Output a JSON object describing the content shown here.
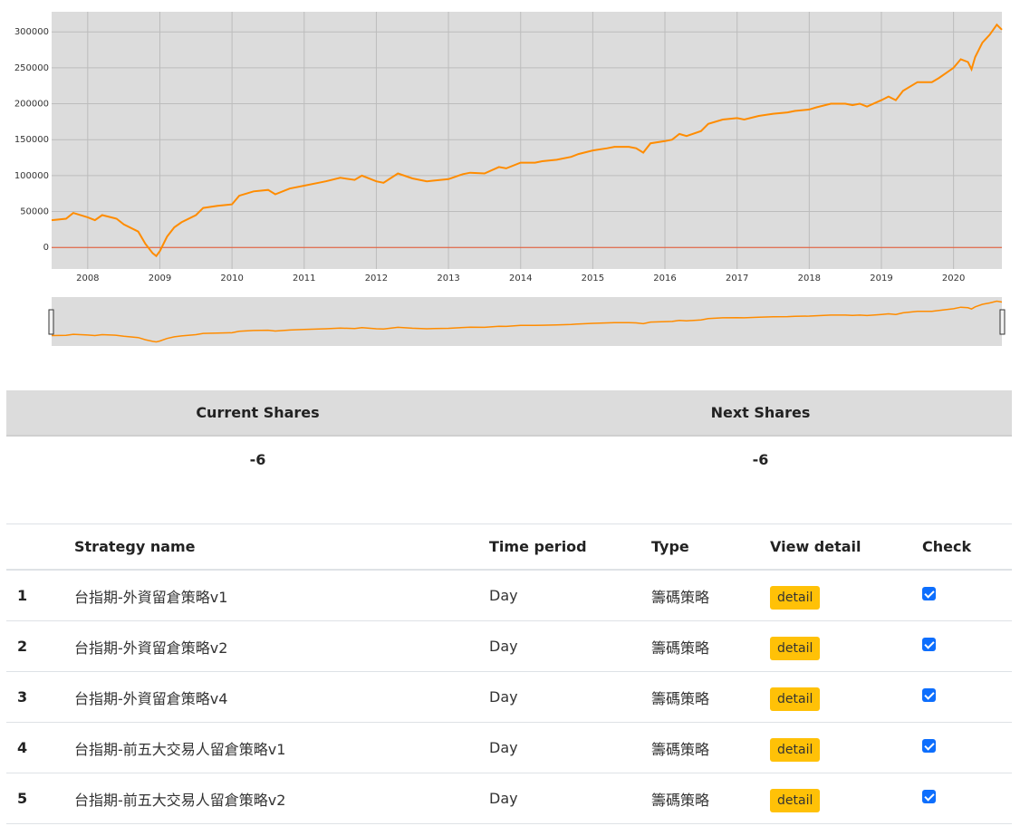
{
  "chart_data": {
    "type": "line",
    "y_ticks": [
      0,
      50000,
      100000,
      150000,
      200000,
      250000,
      300000
    ],
    "x_ticks": [
      "2008",
      "2009",
      "2010",
      "2011",
      "2012",
      "2013",
      "2014",
      "2015",
      "2016",
      "2017",
      "2018",
      "2019",
      "2020"
    ],
    "ylim": [
      -30000,
      328000
    ],
    "xlim": [
      2007.5,
      2020.67
    ],
    "grid": true,
    "baseline": 0,
    "colors": {
      "line": "#ff8c00",
      "baseline": "#e8572e",
      "plot_bg": "#dcdcdc",
      "grid": "#bcbcbc"
    },
    "series": [
      {
        "x": [
          2007.5,
          2007.7,
          2007.8,
          2008.0,
          2008.1,
          2008.2,
          2008.4,
          2008.5,
          2008.7,
          2008.8,
          2008.9,
          2008.95,
          2009.0,
          2009.1,
          2009.2,
          2009.3,
          2009.5,
          2009.6,
          2009.8,
          2010.0,
          2010.1,
          2010.3,
          2010.5,
          2010.6,
          2010.8,
          2011.0,
          2011.2,
          2011.3,
          2011.5,
          2011.7,
          2011.8,
          2012.0,
          2012.1,
          2012.3,
          2012.5,
          2012.7,
          2012.8,
          2013.0,
          2013.2,
          2013.3,
          2013.5,
          2013.7,
          2013.8,
          2014.0,
          2014.2,
          2014.3,
          2014.5,
          2014.7,
          2014.8,
          2015.0,
          2015.2,
          2015.3,
          2015.5,
          2015.6,
          2015.7,
          2015.8,
          2016.0,
          2016.1,
          2016.2,
          2016.3,
          2016.5,
          2016.6,
          2016.8,
          2017.0,
          2017.1,
          2017.3,
          2017.5,
          2017.7,
          2017.8,
          2018.0,
          2018.1,
          2018.3,
          2018.5,
          2018.6,
          2018.7,
          2018.8,
          2019.0,
          2019.1,
          2019.2,
          2019.3,
          2019.5,
          2019.7,
          2019.8,
          2020.0,
          2020.1,
          2020.2,
          2020.25,
          2020.3,
          2020.4,
          2020.5,
          2020.6,
          2020.67
        ],
        "y": [
          38000,
          40000,
          48000,
          42000,
          38000,
          45000,
          40000,
          32000,
          22000,
          5000,
          -8000,
          -12000,
          -5000,
          15000,
          28000,
          35000,
          45000,
          55000,
          58000,
          60000,
          72000,
          78000,
          80000,
          74000,
          82000,
          86000,
          90000,
          92000,
          97000,
          94000,
          100000,
          92000,
          90000,
          103000,
          96000,
          92000,
          93000,
          95000,
          102000,
          104000,
          103000,
          112000,
          110000,
          118000,
          118000,
          120000,
          122000,
          126000,
          130000,
          135000,
          138000,
          140000,
          140000,
          138000,
          132000,
          145000,
          148000,
          150000,
          158000,
          155000,
          162000,
          172000,
          178000,
          180000,
          178000,
          183000,
          186000,
          188000,
          190000,
          192000,
          195000,
          200000,
          200000,
          198000,
          200000,
          196000,
          205000,
          210000,
          205000,
          218000,
          230000,
          230000,
          236000,
          250000,
          262000,
          258000,
          248000,
          265000,
          285000,
          296000,
          310000,
          303000
        ]
      }
    ]
  },
  "shares": {
    "headers": [
      "Current Shares",
      "Next Shares"
    ],
    "values": [
      "-6",
      "-6"
    ]
  },
  "strategies": {
    "headers": {
      "name": "Strategy name",
      "period": "Time period",
      "type": "Type",
      "detail": "View detail",
      "check": "Check"
    },
    "rows": [
      {
        "index": "1",
        "name": "台指期-外資留倉策略v1",
        "period": "Day",
        "type": "籌碼策略",
        "detail": "detail",
        "checked": true
      },
      {
        "index": "2",
        "name": "台指期-外資留倉策略v2",
        "period": "Day",
        "type": "籌碼策略",
        "detail": "detail",
        "checked": true
      },
      {
        "index": "3",
        "name": "台指期-外資留倉策略v4",
        "period": "Day",
        "type": "籌碼策略",
        "detail": "detail",
        "checked": true
      },
      {
        "index": "4",
        "name": "台指期-前五大交易人留倉策略v1",
        "period": "Day",
        "type": "籌碼策略",
        "detail": "detail",
        "checked": true
      },
      {
        "index": "5",
        "name": "台指期-前五大交易人留倉策略v2",
        "period": "Day",
        "type": "籌碼策略",
        "detail": "detail",
        "checked": true
      }
    ]
  }
}
